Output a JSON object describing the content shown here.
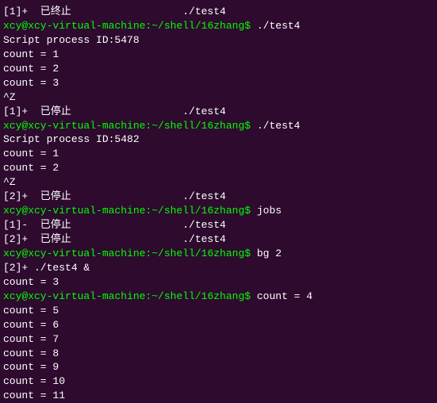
{
  "terminal": {
    "lines": [
      {
        "type": "job",
        "text": "[1]+  已终止                  ./test4"
      },
      {
        "type": "prompt",
        "text": "xcy@xcy-virtual-machine:~/shell/16zhang$ ./test4"
      },
      {
        "type": "output",
        "text": "Script process ID:5478"
      },
      {
        "type": "output",
        "text": "count = 1"
      },
      {
        "type": "output",
        "text": "count = 2"
      },
      {
        "type": "output",
        "text": "count = 3"
      },
      {
        "type": "output",
        "text": "^Z"
      },
      {
        "type": "job",
        "text": "[1]+  已停止                  ./test4"
      },
      {
        "type": "prompt",
        "text": "xcy@xcy-virtual-machine:~/shell/16zhang$ ./test4"
      },
      {
        "type": "output",
        "text": "Script process ID:5482"
      },
      {
        "type": "output",
        "text": "count = 1"
      },
      {
        "type": "output",
        "text": "count = 2"
      },
      {
        "type": "output",
        "text": "^Z"
      },
      {
        "type": "job",
        "text": "[2]+  已停止                  ./test4"
      },
      {
        "type": "prompt",
        "text": "xcy@xcy-virtual-machine:~/shell/16zhang$ jobs"
      },
      {
        "type": "output",
        "text": "[1]-  已停止                  ./test4"
      },
      {
        "type": "output",
        "text": "[2]+  已停止                  ./test4"
      },
      {
        "type": "prompt",
        "text": "xcy@xcy-virtual-machine:~/shell/16zhang$ bg 2"
      },
      {
        "type": "output",
        "text": "[2]+ ./test4 &"
      },
      {
        "type": "output",
        "text": "count = 3"
      },
      {
        "type": "prompt-inline",
        "text": "xcy@xcy-virtual-machine:~/shell/16zhang$ count = 4"
      },
      {
        "type": "output",
        "text": "count = 5"
      },
      {
        "type": "output",
        "text": "count = 6"
      },
      {
        "type": "output",
        "text": "count = 7"
      },
      {
        "type": "output",
        "text": "count = 8"
      },
      {
        "type": "output",
        "text": "count = 9"
      },
      {
        "type": "output",
        "text": "count = 10"
      },
      {
        "type": "output",
        "text": "count = 11"
      }
    ]
  }
}
